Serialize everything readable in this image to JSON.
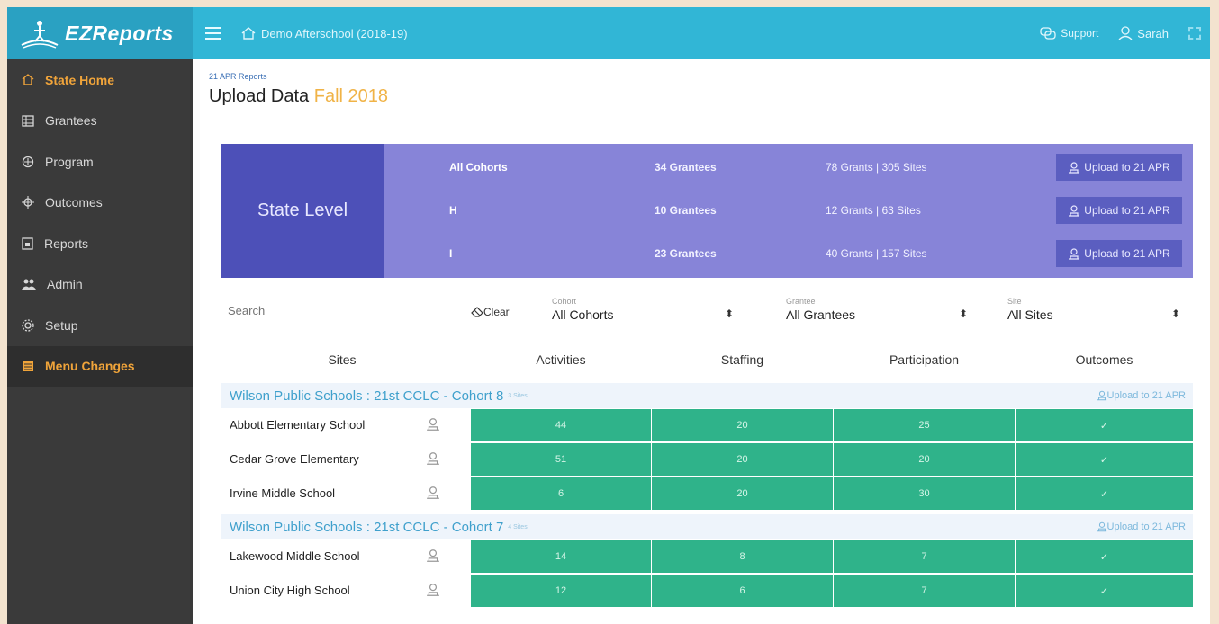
{
  "header": {
    "app_name": "EZReports",
    "org_name": "Demo Afterschool (2018-19)",
    "support_label": "Support",
    "user_name": "Sarah"
  },
  "sidebar": {
    "items": [
      {
        "label": "State Home",
        "icon": "home-icon"
      },
      {
        "label": "Grantees",
        "icon": "grid-icon"
      },
      {
        "label": "Program",
        "icon": "program-icon"
      },
      {
        "label": "Outcomes",
        "icon": "target-icon"
      },
      {
        "label": "Reports",
        "icon": "report-icon"
      },
      {
        "label": "Admin",
        "icon": "users-icon"
      },
      {
        "label": "Setup",
        "icon": "gear-icon"
      },
      {
        "label": "Menu Changes",
        "icon": "list-icon"
      }
    ]
  },
  "page": {
    "breadcrumb": "21 APR Reports",
    "title": "Upload Data",
    "term": "Fall 2018"
  },
  "state": {
    "label": "State Level",
    "rows": [
      {
        "cohort": "All Cohorts",
        "grantees": "34 Grantees",
        "grants": "78 Grants | 305 Sites",
        "upload": "Upload to 21 APR"
      },
      {
        "cohort": "H",
        "grantees": "10 Grantees",
        "grants": "12 Grants | 63 Sites",
        "upload": "Upload to 21 APR"
      },
      {
        "cohort": "I",
        "grantees": "23 Grantees",
        "grants": "40 Grants | 157 Sites",
        "upload": "Upload to 21 APR"
      }
    ]
  },
  "filters": {
    "search_placeholder": "Search",
    "clear_label": "Clear",
    "cohort": {
      "label": "Cohort",
      "value": "All Cohorts"
    },
    "grantee": {
      "label": "Grantee",
      "value": "All Grantees"
    },
    "site": {
      "label": "Site",
      "value": "All Sites"
    }
  },
  "table": {
    "columns": [
      "Sites",
      "Activities",
      "Staffing",
      "Participation",
      "Outcomes"
    ]
  },
  "groups": [
    {
      "name": "Wilson Public Schools : 21st CCLC - Cohort 8",
      "count": "3 Sites",
      "upload": "Upload to 21 APR",
      "sites": [
        {
          "name": "Abbott Elementary School",
          "activities": "44",
          "staffing": "20",
          "participation": "25",
          "outcomes": "✓"
        },
        {
          "name": "Cedar Grove Elementary",
          "activities": "51",
          "staffing": "20",
          "participation": "20",
          "outcomes": "✓"
        },
        {
          "name": "Irvine Middle School",
          "activities": "6",
          "staffing": "20",
          "participation": "30",
          "outcomes": "✓"
        }
      ]
    },
    {
      "name": "Wilson Public Schools : 21st CCLC - Cohort 7",
      "count": "4 Sites",
      "upload": "Upload to 21 APR",
      "sites": [
        {
          "name": "Lakewood Middle School",
          "activities": "14",
          "staffing": "8",
          "participation": "7",
          "outcomes": "✓"
        },
        {
          "name": "Union City High School",
          "activities": "12",
          "staffing": "6",
          "participation": "7",
          "outcomes": "✓"
        }
      ]
    }
  ],
  "colors": {
    "topbar": "#31b6d6",
    "sidebar": "#3a3a3a",
    "accent": "#f0a43a",
    "state_panel": "#8784d8",
    "state_label": "#4d50b8",
    "cell_green": "#2fb38a"
  }
}
